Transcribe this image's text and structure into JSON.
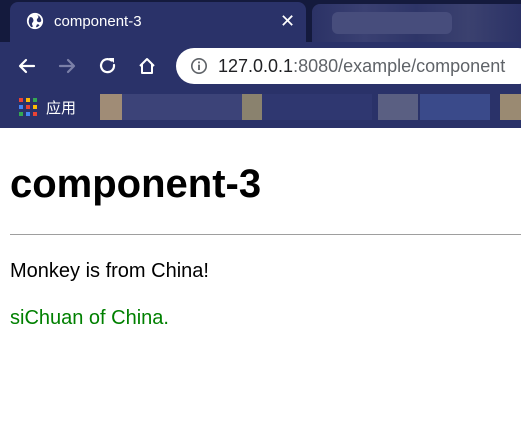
{
  "browser": {
    "tab": {
      "title": "component-3",
      "favicon": "globe-icon",
      "close_icon": "close-icon"
    },
    "toolbar": {
      "back_icon": "arrow-left-icon",
      "forward_icon": "arrow-right-icon",
      "reload_icon": "reload-icon",
      "home_icon": "home-icon",
      "url_host": "127.0.0.1",
      "url_path": ":8080/example/component"
    },
    "bookmarks": {
      "apps_label": "应用"
    }
  },
  "page": {
    "heading": "component-3",
    "line1": "Monkey is from China!",
    "line2": "siChuan of China.",
    "line2_color": "#008000"
  },
  "colors": {
    "chrome_dark": "#141a3d",
    "chrome": "#2a3269"
  }
}
